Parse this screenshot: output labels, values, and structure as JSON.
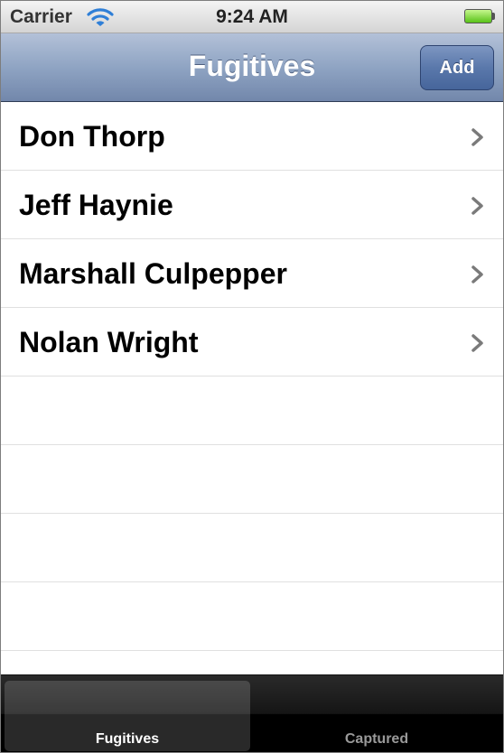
{
  "status_bar": {
    "carrier": "Carrier",
    "time": "9:24 AM",
    "wifi_icon": "wifi-icon",
    "battery_icon": "battery-icon"
  },
  "nav_bar": {
    "title": "Fugitives",
    "add_label": "Add"
  },
  "table": {
    "rows": [
      {
        "label": "Don Thorp"
      },
      {
        "label": "Jeff Haynie"
      },
      {
        "label": "Marshall Culpepper"
      },
      {
        "label": "Nolan Wright"
      }
    ],
    "accessory_icon": "chevron-right-icon"
  },
  "tab_bar": {
    "tabs": [
      {
        "label": "Fugitives",
        "selected": true
      },
      {
        "label": "Captured",
        "selected": false
      }
    ]
  },
  "colors": {
    "nav_bar": "#8fa4c3",
    "add_button": "#5a78ab",
    "battery": "#58c218",
    "tab_bar": "#000000"
  }
}
